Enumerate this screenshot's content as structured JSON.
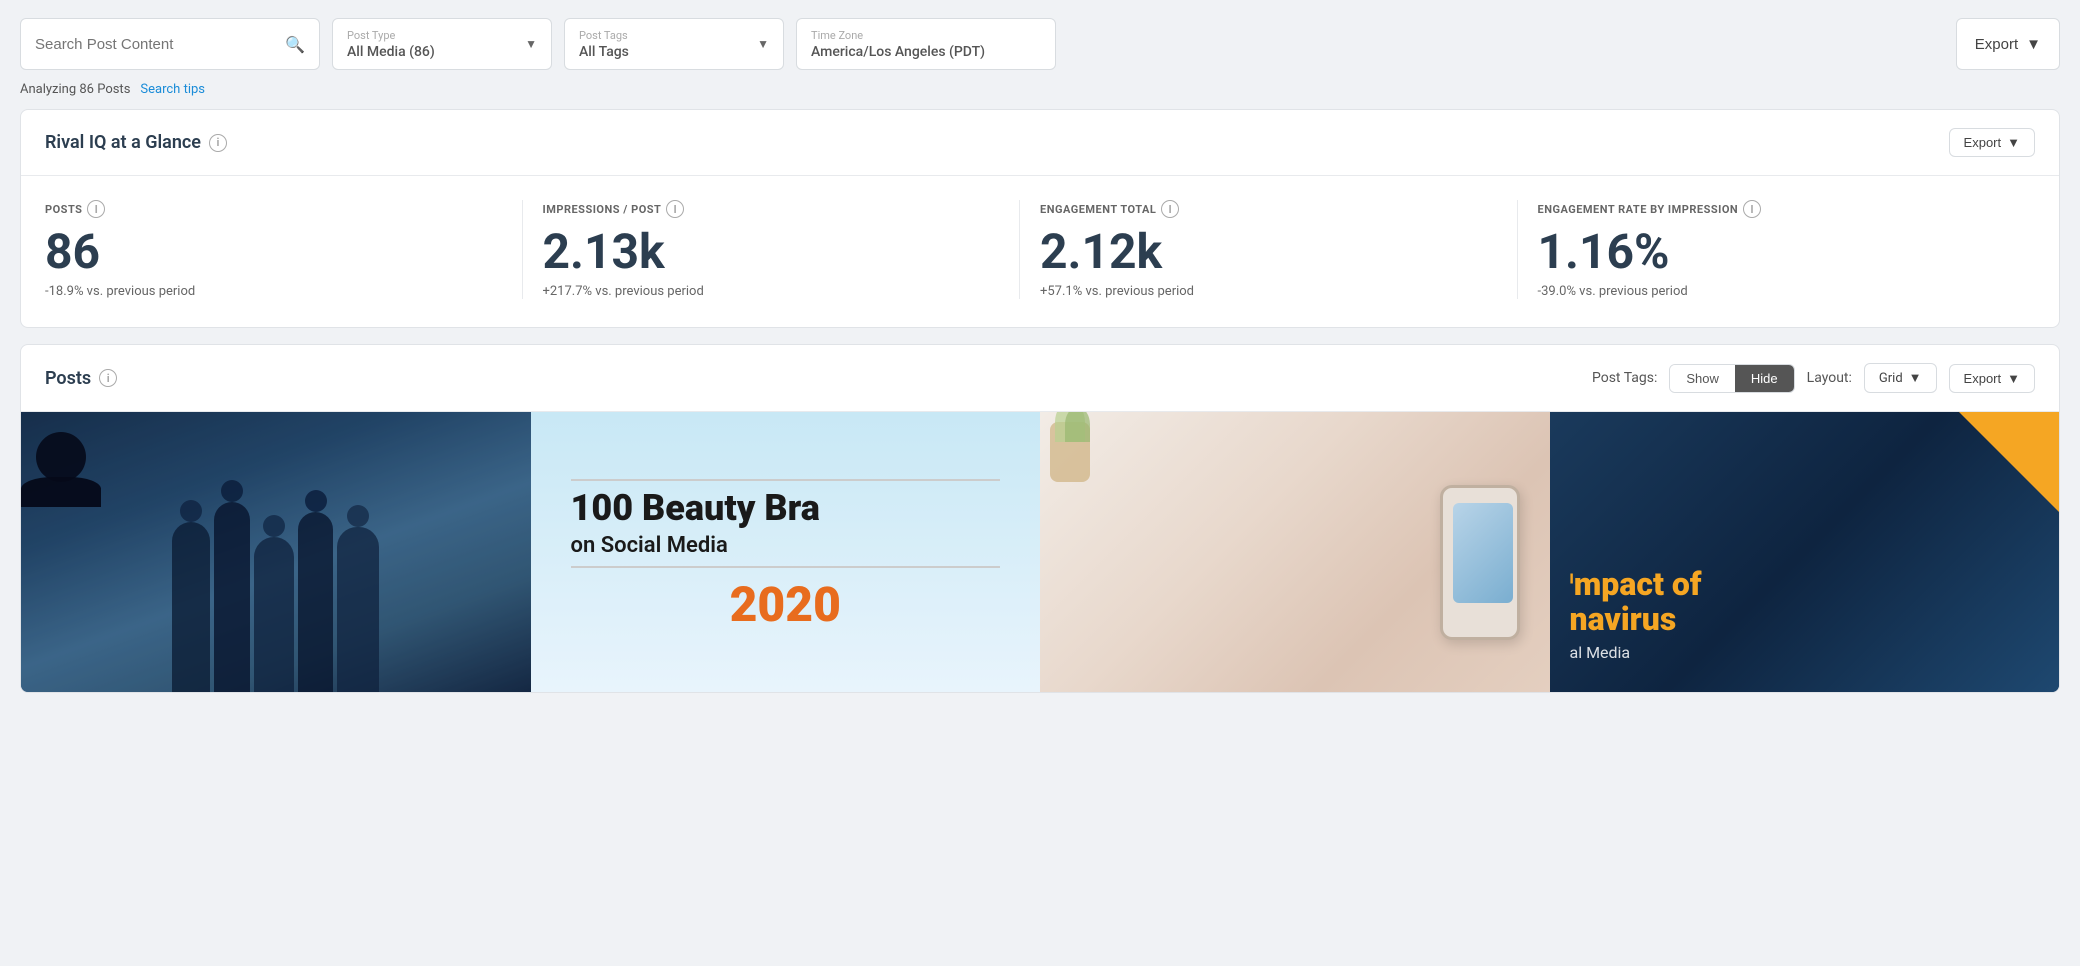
{
  "toolbar": {
    "search": {
      "placeholder": "Search Post Content",
      "value": ""
    },
    "post_type": {
      "label": "Post Type",
      "value": "All Media (86)"
    },
    "post_tags": {
      "label": "Post Tags",
      "value": "All Tags"
    },
    "timezone": {
      "label": "Time Zone",
      "value": "America/Los Angeles (PDT)"
    },
    "export_label": "Export"
  },
  "sub_toolbar": {
    "analyzing_text": "Analyzing 86 Posts",
    "search_tips_label": "Search tips"
  },
  "glance_card": {
    "title": "Rival IQ at a Glance",
    "export_label": "Export",
    "stats": [
      {
        "label": "POSTS",
        "value": "86",
        "change": "-18.9% vs. previous period"
      },
      {
        "label": "IMPRESSIONS / POST",
        "value": "2.13k",
        "change": "+217.7% vs. previous period"
      },
      {
        "label": "ENGAGEMENT TOTAL",
        "value": "2.12k",
        "change": "+57.1% vs. previous period"
      },
      {
        "label": "ENGAGEMENT RATE BY IMPRESSION",
        "value": "1.16%",
        "change": "-39.0% vs. previous period"
      }
    ]
  },
  "posts_card": {
    "title": "Posts",
    "post_tags_label": "Post Tags:",
    "show_label": "Show",
    "hide_label": "Hide",
    "active_toggle": "Hide",
    "layout_label": "Layout:",
    "layout_value": "Grid",
    "export_label": "Export",
    "post_images": [
      {
        "type": "crowd_phones",
        "alt": "People using phones crowd scene"
      },
      {
        "type": "beauty_brands",
        "text1": "100 Beauty Bra",
        "text2": "on Social Media",
        "text3": "2020"
      },
      {
        "type": "hand_phone",
        "alt": "Hand holding phone"
      },
      {
        "type": "impact",
        "title": "mpact of",
        "subtitle": "navirus",
        "desc": "al Media"
      }
    ]
  }
}
